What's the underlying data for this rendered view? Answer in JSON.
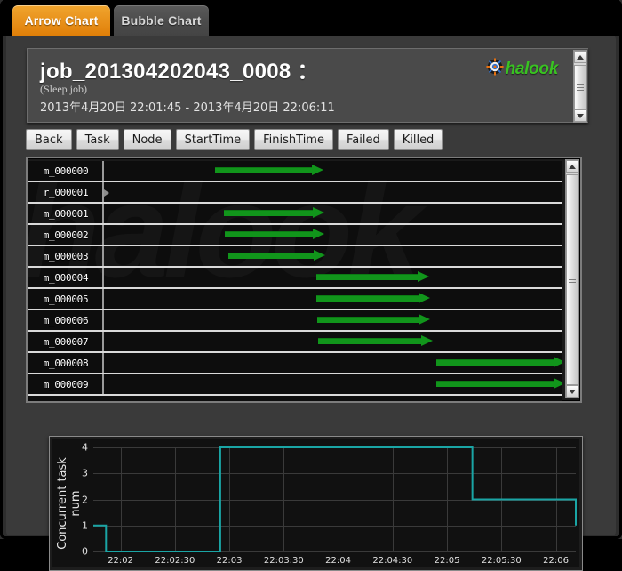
{
  "tabs": [
    {
      "label": "Arrow Chart",
      "active": true
    },
    {
      "label": "Bubble Chart",
      "active": false
    }
  ],
  "job": {
    "title": "job_201304202043_0008 ：",
    "subtitle": "(Sleep job)",
    "time_range": "2013年4月20日 22:01:45 - 2013年4月20日 22:06:11",
    "logo_text": "halook",
    "logo_icon": "gear-icon",
    "logo_color": "#39c222"
  },
  "toolbar": {
    "buttons": [
      "Back",
      "Task",
      "Node",
      "StartTime",
      "FinishTime",
      "Failed",
      "Killed"
    ]
  },
  "arrow_chart": {
    "arrow_color": "#11951b",
    "rows": [
      {
        "label": "m_000000",
        "start_pct": 24.0,
        "end_pct": 47.5,
        "clipped": false
      },
      {
        "label": "r_000001",
        "start_pct": null,
        "end_pct": null,
        "clipped": false,
        "marker": "caret-right-icon"
      },
      {
        "label": "m_000001",
        "start_pct": 26.0,
        "end_pct": 47.8,
        "clipped": false
      },
      {
        "label": "m_000002",
        "start_pct": 26.2,
        "end_pct": 47.8,
        "clipped": false
      },
      {
        "label": "m_000003",
        "start_pct": 27.0,
        "end_pct": 48.0,
        "clipped": false
      },
      {
        "label": "m_000004",
        "start_pct": 46.0,
        "end_pct": 70.5,
        "clipped": false
      },
      {
        "label": "m_000005",
        "start_pct": 46.0,
        "end_pct": 70.8,
        "clipped": false
      },
      {
        "label": "m_000006",
        "start_pct": 46.2,
        "end_pct": 70.8,
        "clipped": false
      },
      {
        "label": "m_000007",
        "start_pct": 46.5,
        "end_pct": 71.2,
        "clipped": false
      },
      {
        "label": "m_000008",
        "start_pct": 72.0,
        "end_pct": 100.0,
        "clipped": true
      },
      {
        "label": "m_000009",
        "start_pct": 72.0,
        "end_pct": 100.0,
        "clipped": true
      }
    ]
  },
  "chart_data": {
    "type": "line",
    "title": "",
    "xlabel": "",
    "ylabel": "Concurrent task num",
    "ylim": [
      0,
      4
    ],
    "yticks": [
      0,
      1,
      2,
      3,
      4
    ],
    "xticks": [
      "22:02",
      "22:02:30",
      "22:03",
      "22:03:30",
      "22:04",
      "22:04:30",
      "22:05",
      "22:05:30",
      "22:06"
    ],
    "grid": true,
    "legend": "none",
    "line_color": "#1aa5a5",
    "series": [
      {
        "name": "Concurrent task num",
        "x": [
          "22:01:45",
          "22:01:52",
          "22:02:48",
          "22:02:55",
          "22:05:05",
          "22:05:14",
          "22:06:02",
          "22:06:11"
        ],
        "values": [
          1,
          0,
          0,
          4,
          4,
          2,
          2,
          1
        ]
      }
    ]
  },
  "scrollbars": {
    "job_panel": {
      "name": "job-header-scrollbar",
      "up": "▲",
      "down": "▼"
    },
    "gantt": {
      "name": "arrow-chart-scrollbar",
      "up": "▲",
      "down": "▼"
    }
  }
}
